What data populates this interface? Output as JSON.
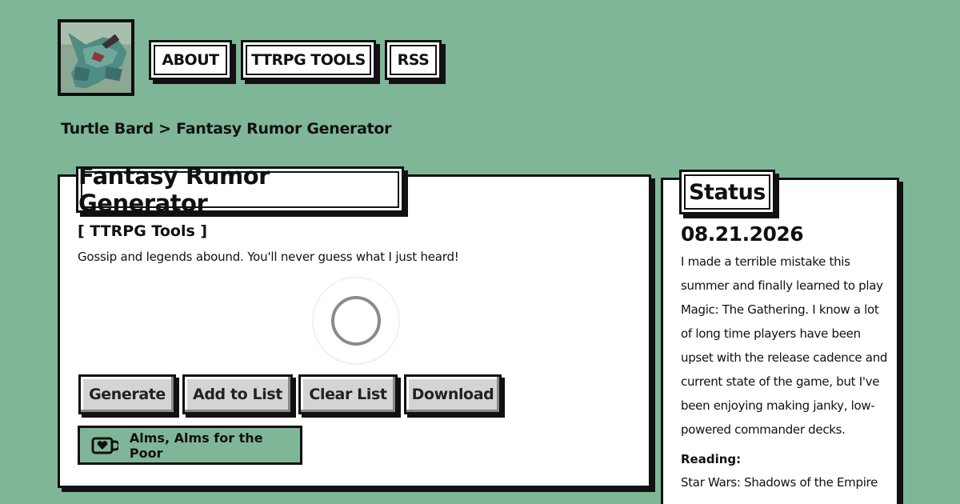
{
  "header": {
    "logo_icon": "turtle-bard-avatar-icon",
    "nav": [
      {
        "label": "ABOUT"
      },
      {
        "label": "TTRPG TOOLS"
      },
      {
        "label": "RSS"
      }
    ]
  },
  "breadcrumb": {
    "root": "Turtle Bard",
    "separator": ">",
    "current": "Fantasy Rumor Generator"
  },
  "main": {
    "title": "Fantasy Rumor Generator",
    "category": "[ TTRPG Tools ]",
    "description": "Gossip and legends abound. You'll never guess what I just heard!",
    "buttons": {
      "generate": "Generate",
      "add": "Add to List",
      "clear": "Clear List",
      "download": "Download"
    },
    "donate": {
      "label": "Alms, Alms for the Poor",
      "icon": "coffee-heart-icon"
    }
  },
  "status": {
    "title": "Status",
    "date": "08.21.2026",
    "text": "I made a terrible mistake this summer and finally learned to play Magic: The Gathering. I know a lot of long time players have been upset with the release cadence and current state of the game, but I've been enjoying making janky, low-powered commander decks.",
    "reading_label": "Reading:",
    "reading_value": "Star Wars: Shadows of the Empire"
  },
  "colors": {
    "background": "#80b698",
    "panel": "#ffffff",
    "border": "#111111",
    "button": "#d4d4d4"
  }
}
